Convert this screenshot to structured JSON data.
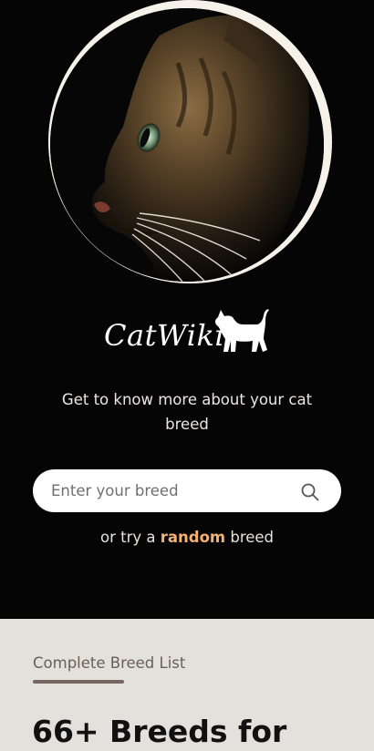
{
  "hero": {
    "logo_text": "CatWiki",
    "tagline": "Get to know more about your cat breed",
    "search": {
      "placeholder": "Enter your breed",
      "value": ""
    },
    "random": {
      "prefix": "or try a",
      "link": "random",
      "suffix": "breed"
    }
  },
  "breeds": {
    "section_label": "Complete Breed List",
    "heading": "66+ Breeds for"
  },
  "colors": {
    "background_dark": "#050505",
    "accent": "#f3b273",
    "section_bg": "#e3e1dc"
  },
  "icons": {
    "search": "search-icon",
    "logo": "cat-silhouette-icon"
  }
}
